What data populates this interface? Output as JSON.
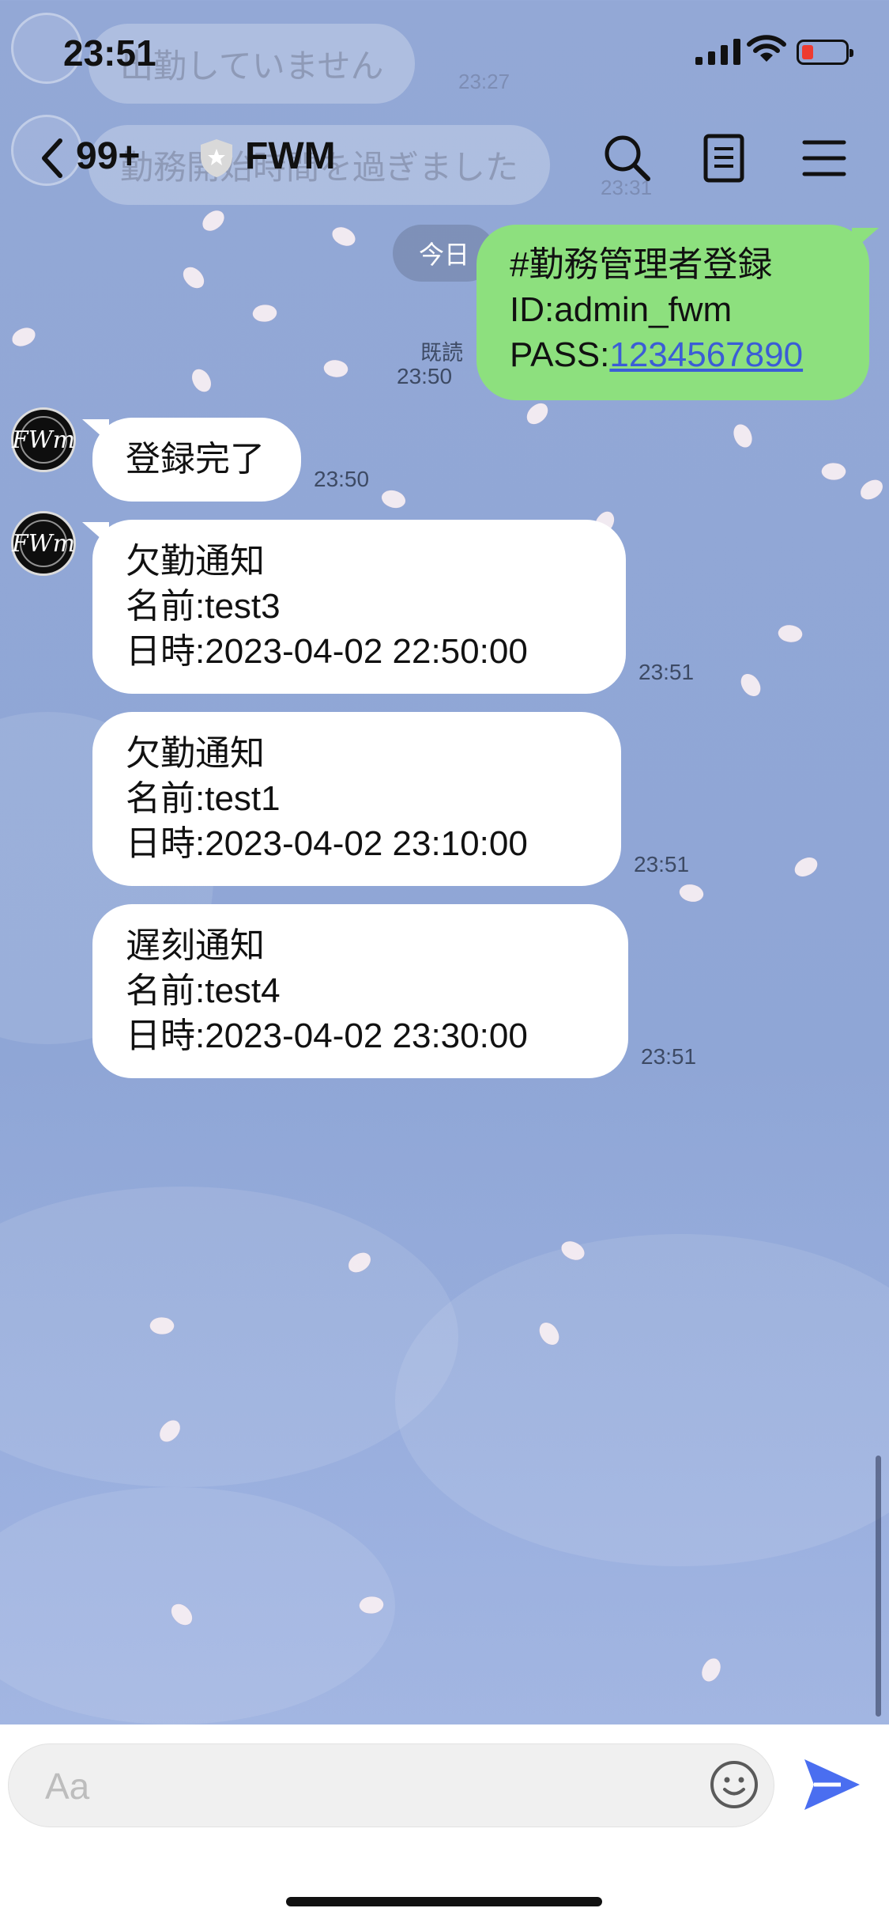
{
  "status_bar": {
    "time": "23:51"
  },
  "background_notifications": [
    {
      "text": "出勤していません",
      "time": "23:27"
    },
    {
      "text": "勤務開始時間を過ぎました",
      "time": "23:31"
    }
  ],
  "header": {
    "back_icon": "chevron-left-icon",
    "unread_count": "99+",
    "title": "FWM",
    "icons": [
      "search-icon",
      "notes-icon",
      "menu-icon"
    ]
  },
  "messages": {
    "date_divider": "今日",
    "sent": {
      "line1": "#勤務管理者登録",
      "line2": "ID:admin_fwm",
      "line3_prefix": "PASS:",
      "line3_link": "1234567890",
      "read_status": "既読",
      "time": "23:50"
    },
    "received": [
      {
        "lines": [
          "登録完了"
        ],
        "time": "23:50"
      },
      {
        "lines": [
          "欠勤通知",
          "名前:test3",
          "日時:2023-04-02 22:50:00"
        ],
        "time": "23:51"
      },
      {
        "lines": [
          "欠勤通知",
          "名前:test1",
          "日時:2023-04-02 23:10:00"
        ],
        "time": "23:51"
      },
      {
        "lines": [
          "遅刻通知",
          "名前:test4",
          "日時:2023-04-02 23:30:00"
        ],
        "time": "23:51"
      }
    ],
    "avatar_label": "FWm"
  },
  "input_bar": {
    "placeholder": "Aa",
    "emoji_icon": "smiley-icon",
    "send_icon": "send-icon"
  },
  "colors": {
    "sent_bubble": "#8de07e",
    "link": "#3b5dd6",
    "send": "#4a6ef0"
  }
}
